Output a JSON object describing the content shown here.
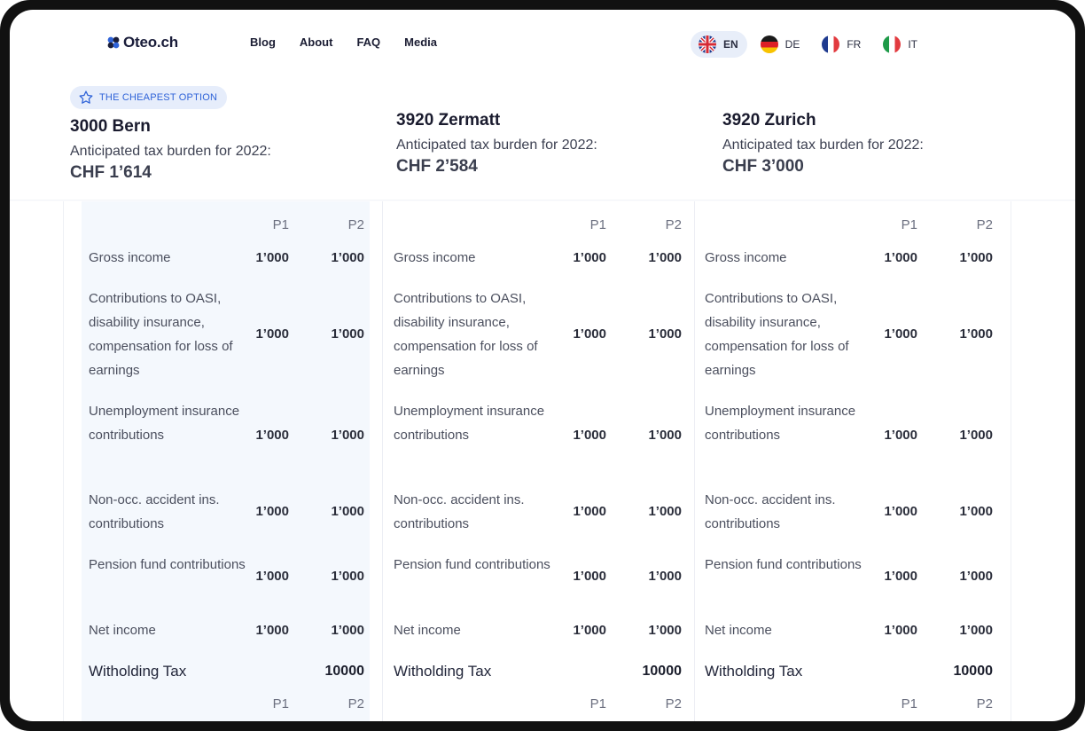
{
  "brand": {
    "name": "Oteo.ch"
  },
  "nav": {
    "items": [
      "Blog",
      "About",
      "FAQ",
      "Media"
    ]
  },
  "languages": [
    {
      "code": "EN",
      "flag": "uk-flag-icon",
      "active": true
    },
    {
      "code": "DE",
      "flag": "germany-flag-icon",
      "active": false
    },
    {
      "code": "FR",
      "flag": "france-flag-icon",
      "active": false
    },
    {
      "code": "IT",
      "flag": "italy-flag-icon",
      "active": false
    }
  ],
  "badge": {
    "label": "THE CHEAPEST OPTION",
    "icon": "star-icon"
  },
  "columns": [
    {
      "city": "3000 Bern",
      "anticipated": "Anticipated tax burden for 2022:",
      "amount": "CHF 1’614",
      "cheapest": true
    },
    {
      "city": "3920 Zermatt",
      "anticipated": "Anticipated tax burden for 2022:",
      "amount": "CHF 2’584",
      "cheapest": false
    },
    {
      "city": "3920 Zurich",
      "anticipated": "Anticipated tax burden for 2022:",
      "amount": "CHF 3’000",
      "cheapest": false
    }
  ],
  "table": {
    "persons": [
      "P1",
      "P2"
    ],
    "rows": [
      {
        "label": "Gross income",
        "p1": "1’000",
        "p2": "1’000"
      },
      {
        "label": "Contributions to OASI, disability insurance, compensation for loss of earnings",
        "p1": "1’000",
        "p2": "1’000"
      },
      {
        "label": "Unemployment insurance contributions",
        "p1": "1’000",
        "p2": "1’000"
      },
      {
        "label": "Non-occ. accident ins. contributions",
        "p1": "1’000",
        "p2": "1’000"
      },
      {
        "label": "Pension fund contributions",
        "p1": "1’000",
        "p2": "1’000"
      },
      {
        "label": "Net income",
        "p1": "1’000",
        "p2": "1’000"
      }
    ],
    "withholding": {
      "label": "Witholding Tax",
      "value": "10000"
    }
  },
  "colors": {
    "accent": "#2f63d8",
    "highlight": "#f4f8fd",
    "badge_bg": "#e6edfb"
  }
}
